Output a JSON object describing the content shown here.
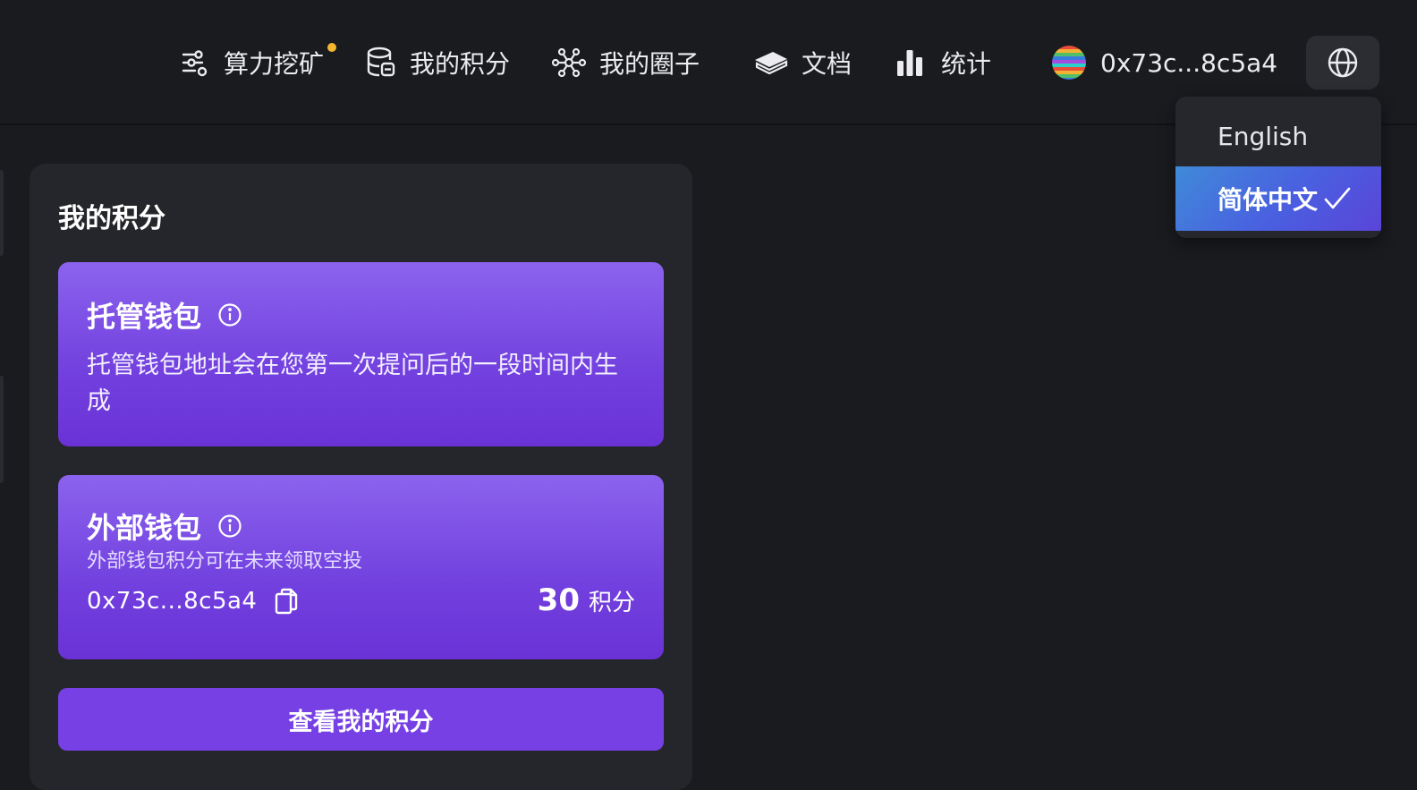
{
  "nav": {
    "mining": {
      "label": "算力挖矿",
      "icon": "mining-icon",
      "badge_color": "#f5b731"
    },
    "points": {
      "label": "我的积分",
      "icon": "database-icon"
    },
    "circle": {
      "label": "我的圈子",
      "icon": "network-icon"
    },
    "docs": {
      "label": "文档",
      "icon": "book-icon"
    },
    "stats": {
      "label": "统计",
      "icon": "bar-chart-icon"
    },
    "account": {
      "label": "0x73c...8c5a4",
      "icon": "avatar"
    },
    "language_button": {
      "icon": "globe-icon"
    }
  },
  "language_menu": {
    "options": [
      {
        "label": "English",
        "selected": false
      },
      {
        "label": "简体中文",
        "selected": true
      }
    ]
  },
  "panel": {
    "title": "我的积分",
    "custodial_wallet": {
      "title": "托管钱包",
      "description": "托管钱包地址会在您第一次提问后的一段时间内生成"
    },
    "external_wallet": {
      "title": "外部钱包",
      "subtitle": "外部钱包积分可在未来领取空投",
      "address": "0x73c...8c5a4",
      "points_value": "30",
      "points_unit": "积分"
    },
    "view_button": "查看我的积分"
  },
  "colors": {
    "background": "#1a1b1f",
    "panel": "#25262b",
    "card_gradient_top": "#8b63ee",
    "card_gradient_bottom": "#6a32d6",
    "primary_button": "#7740e5",
    "selected_language": "#4a5fe0"
  }
}
